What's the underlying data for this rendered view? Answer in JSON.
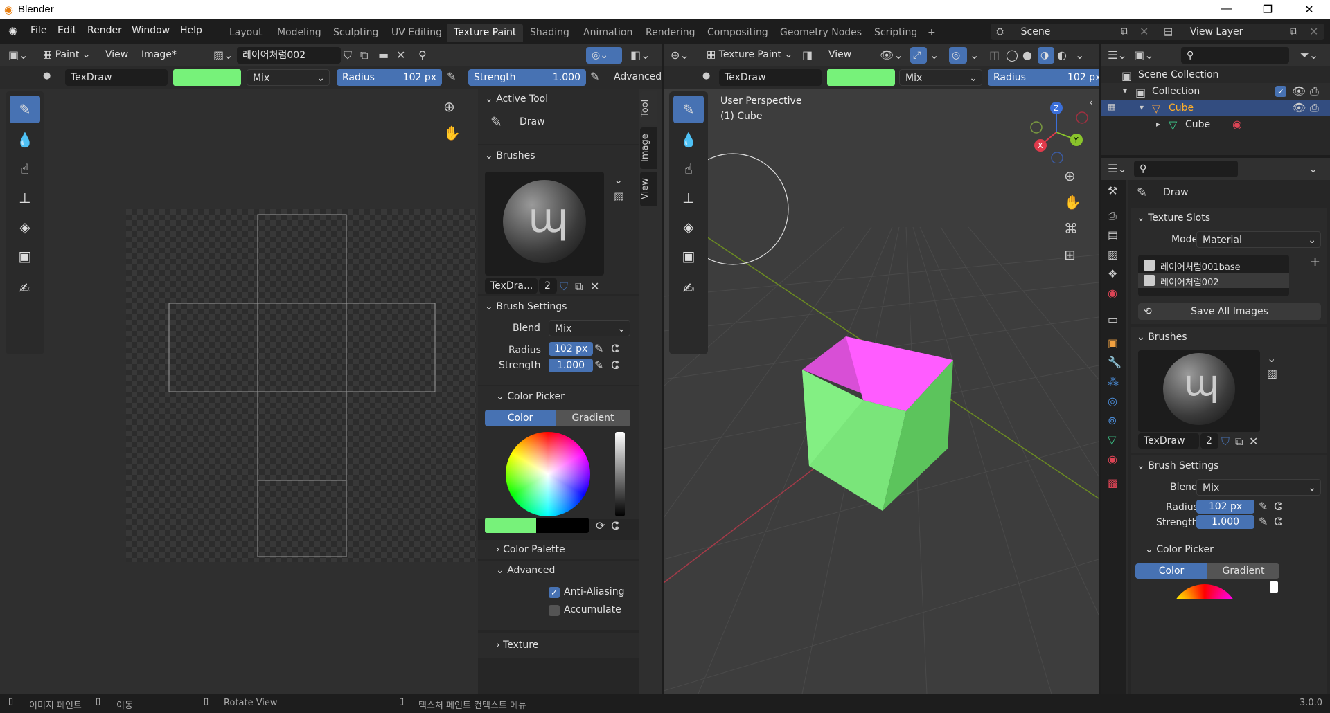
{
  "window": {
    "title": "Blender",
    "min": "—",
    "max": "❐",
    "close": "✕"
  },
  "menu": [
    "File",
    "Edit",
    "Render",
    "Window",
    "Help"
  ],
  "workspaces": [
    "Layout",
    "Modeling",
    "Sculpting",
    "UV Editing",
    "Texture Paint",
    "Shading",
    "Animation",
    "Rendering",
    "Compositing",
    "Geometry Nodes",
    "Scripting",
    "+"
  ],
  "scene": {
    "scene_label": "Scene",
    "view_layer": "View Layer"
  },
  "image_editor": {
    "mode": "Paint",
    "view": "View",
    "image": "Image*",
    "image_name": "레이어처럼002",
    "brush": "TexDraw",
    "blend": "Mix",
    "radius_label": "Radius",
    "radius": "102 px",
    "strength_label": "Strength",
    "strength": "1.000",
    "advanced": "Advanced",
    "color": "#77f27a"
  },
  "sidebar": {
    "tabs": [
      "Tool",
      "Image",
      "View"
    ],
    "active_tool": "Active Tool",
    "draw": "Draw",
    "brushes": "Brushes",
    "brush_name": "TexDra...",
    "brush_users": "2",
    "brush_settings": "Brush Settings",
    "blend_label": "Blend",
    "blend": "Mix",
    "radius_label": "Radius",
    "radius": "102 px",
    "strength_label": "Strength",
    "strength": "1.000",
    "color_picker": "Color Picker",
    "color_tab": "Color",
    "gradient_tab": "Gradient",
    "color_palette": "Color Palette",
    "advanced": "Advanced",
    "anti_aliasing": "Anti-Aliasing",
    "accumulate": "Accumulate",
    "texture": "Texture"
  },
  "viewport": {
    "mode": "Texture Paint",
    "view": "View",
    "brush": "TexDraw",
    "blend": "Mix",
    "radius_label": "Radius",
    "radius": "102 px",
    "perspective": "User Perspective",
    "object": "(1) Cube",
    "gizmo": {
      "x": "X",
      "y": "Y",
      "z": "Z"
    }
  },
  "outliner": {
    "scene_collection": "Scene Collection",
    "collection": "Collection",
    "cube_obj": "Cube",
    "cube_mesh": "Cube"
  },
  "properties": {
    "draw": "Draw",
    "texture_slots": "Texture Slots",
    "mode_label": "Mode",
    "mode": "Material",
    "slots": [
      "레이어처럼001base",
      "레이어처럼002"
    ],
    "save_all": "Save All Images",
    "brushes": "Brushes",
    "brush_name": "TexDraw",
    "brush_users": "2",
    "brush_settings": "Brush Settings",
    "blend_label": "Blend",
    "blend": "Mix",
    "radius_label": "Radius",
    "radius": "102 px",
    "strength_label": "Strength",
    "strength": "1.000",
    "color_picker": "Color Picker",
    "color_tab": "Color",
    "gradient_tab": "Gradient"
  },
  "statusbar": {
    "left1": "이미지 페인트",
    "left2": "이동",
    "mid": "Rotate View",
    "ctx": "텍스처 페인트 컨텍스트 메뉴",
    "version": "3.0.0"
  }
}
